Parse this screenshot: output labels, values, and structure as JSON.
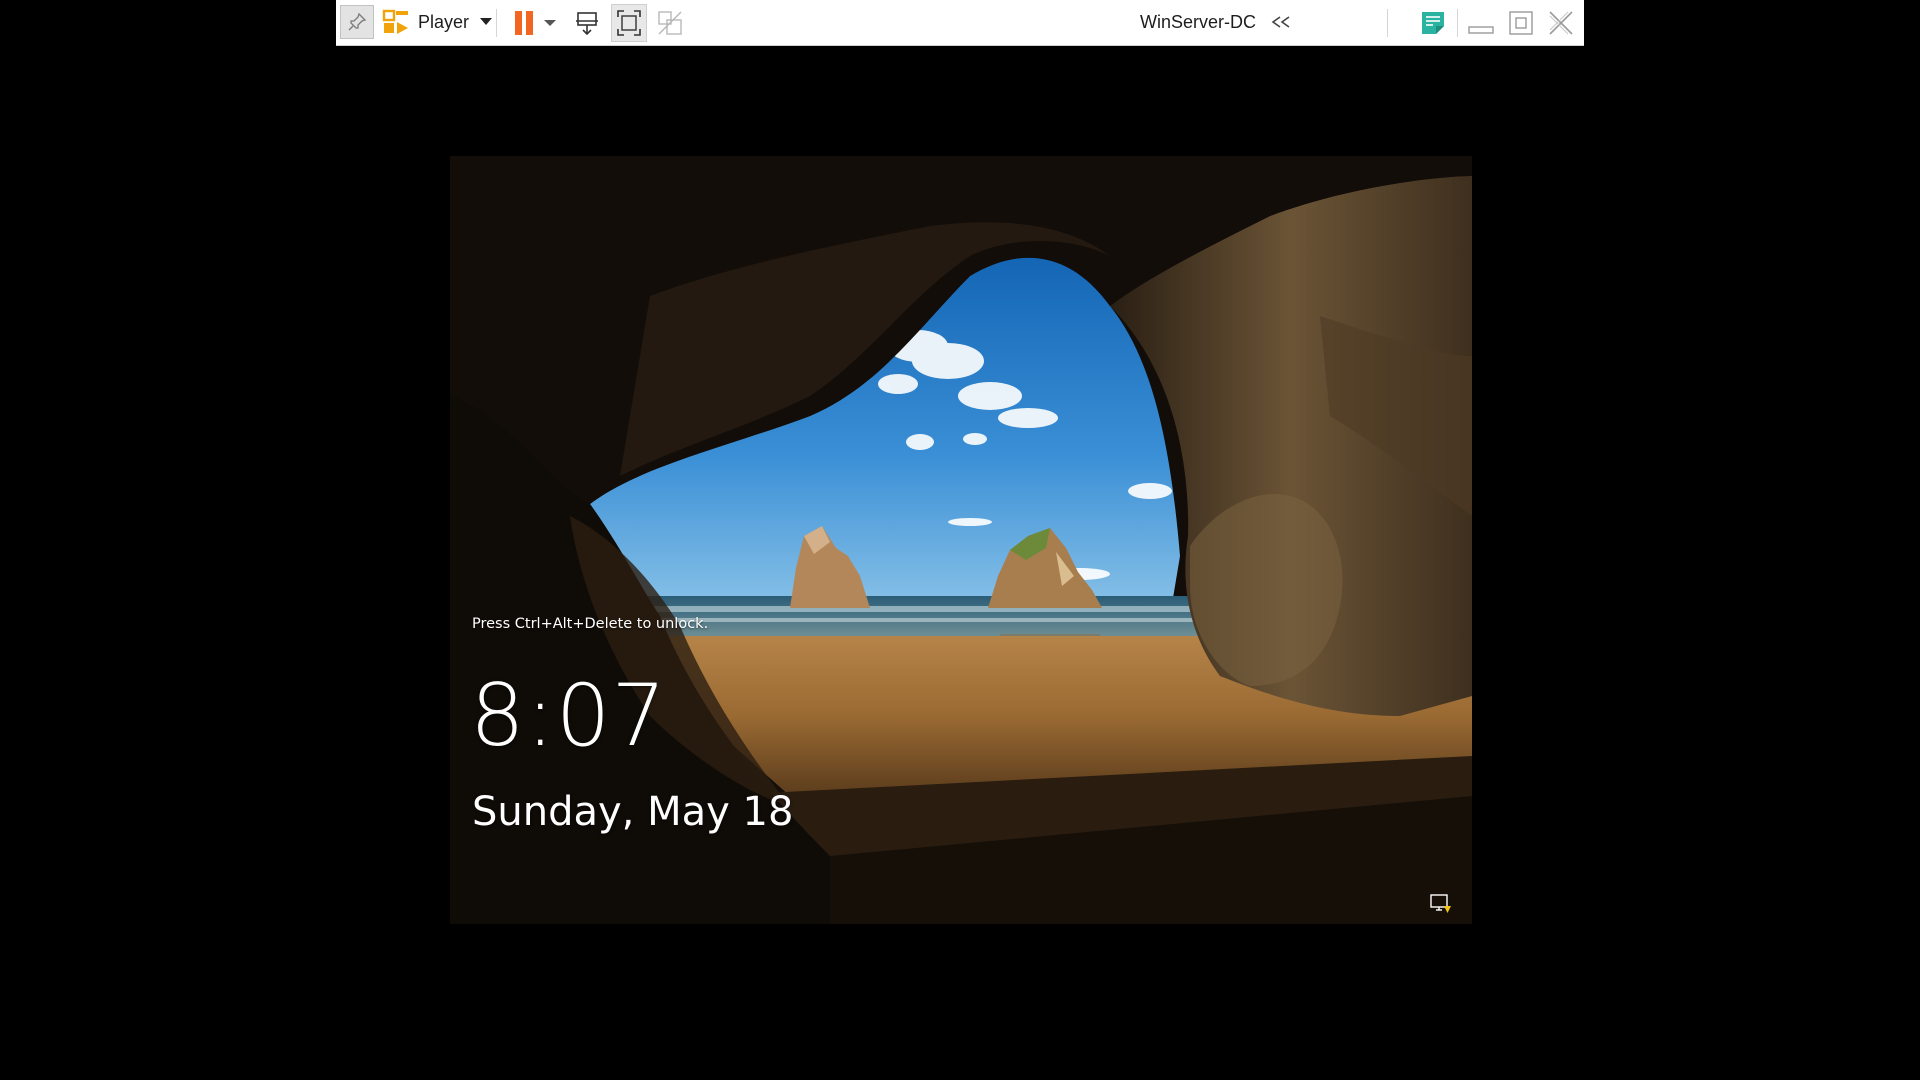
{
  "toolbar": {
    "app_menu_label": "Player",
    "vm_name": "WinServer-DC",
    "icons": {
      "pin": "pin-icon",
      "player_logo": "vmware-player-icon",
      "dropdown": "dropdown-arrow-icon",
      "pause": "pause-icon",
      "pause_dropdown": "dropdown-arrow-icon",
      "send_keys": "send-ctrl-alt-del-icon",
      "full_screen": "full-screen-icon",
      "unity": "unity-icon",
      "collapse": "double-chevron-left-icon",
      "notes": "message-log-icon",
      "minimize": "minimize-icon",
      "restore": "restore-icon",
      "close": "close-icon"
    },
    "colors": {
      "pause": "#f26522",
      "player_logo": "#f0a30a",
      "notes": "#2ab3a0"
    }
  },
  "lock_screen": {
    "unlock_hint": "Press Ctrl+Alt+Delete to unlock.",
    "time": "8:07",
    "date": "Sunday, May 18",
    "network_icon": "network-status-icon"
  }
}
